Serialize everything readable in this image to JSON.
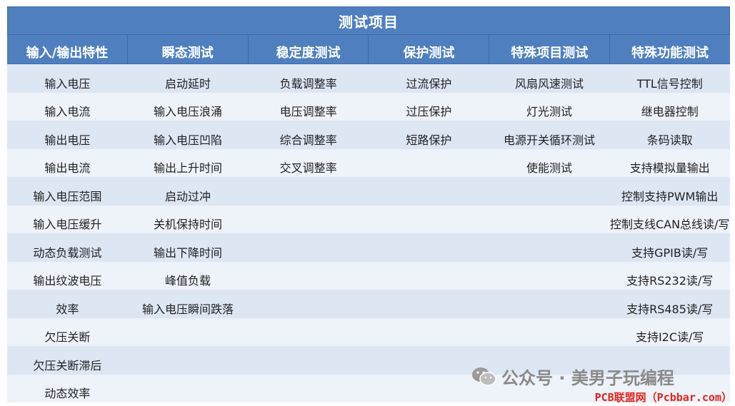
{
  "table": {
    "title": "测试项目",
    "headers": [
      "输入/输出特性",
      "瞬态测试",
      "稳定度测试",
      "保护测试",
      "特殊项目测试",
      "特殊功能测试"
    ],
    "rows": [
      [
        "输入电压",
        "启动延时",
        "负载调整率",
        "过流保护",
        "风扇风速测试",
        "TTL信号控制"
      ],
      [
        "输入电流",
        "输入电压浪涌",
        "电压调整率",
        "过压保护",
        "灯光测试",
        "继电器控制"
      ],
      [
        "输出电压",
        "输入电压凹陷",
        "综合调整率",
        "短路保护",
        "电源开关循环测试",
        "条码读取"
      ],
      [
        "输出电流",
        "输出上升时间",
        "交叉调整率",
        "",
        "使能测试",
        "支持模拟量输出"
      ],
      [
        "输入电压范围",
        "启动过冲",
        "",
        "",
        "",
        "控制支持PWM输出"
      ],
      [
        "输入电压缓升",
        "关机保持时间",
        "",
        "",
        "",
        "控制支线CAN总线读/写"
      ],
      [
        "动态负载测试",
        "输出下降时间",
        "",
        "",
        "",
        "支持GPIB读/写"
      ],
      [
        "输出纹波电压",
        "峰值负载",
        "",
        "",
        "",
        "支持RS232读/写"
      ],
      [
        "效率",
        "输入电压瞬间跌落",
        "",
        "",
        "",
        "支持RS485读/写"
      ],
      [
        "欠压关断",
        "",
        "",
        "",
        "",
        "支持I2C读/写"
      ],
      [
        "欠压关断滞后",
        "",
        "",
        "",
        "",
        ""
      ],
      [
        "动态效率",
        "",
        "",
        "",
        "",
        ""
      ]
    ]
  },
  "watermark": {
    "text": "公众号 · 美男子玩编程",
    "icon": "wechat-icon"
  },
  "credit": "PCB联盟网（Pcbbar.com）",
  "colors": {
    "header_bg": "#4f7fbf",
    "row_odd": "#dde6f3",
    "row_even": "#eef2f9",
    "credit": "#e0261e"
  }
}
